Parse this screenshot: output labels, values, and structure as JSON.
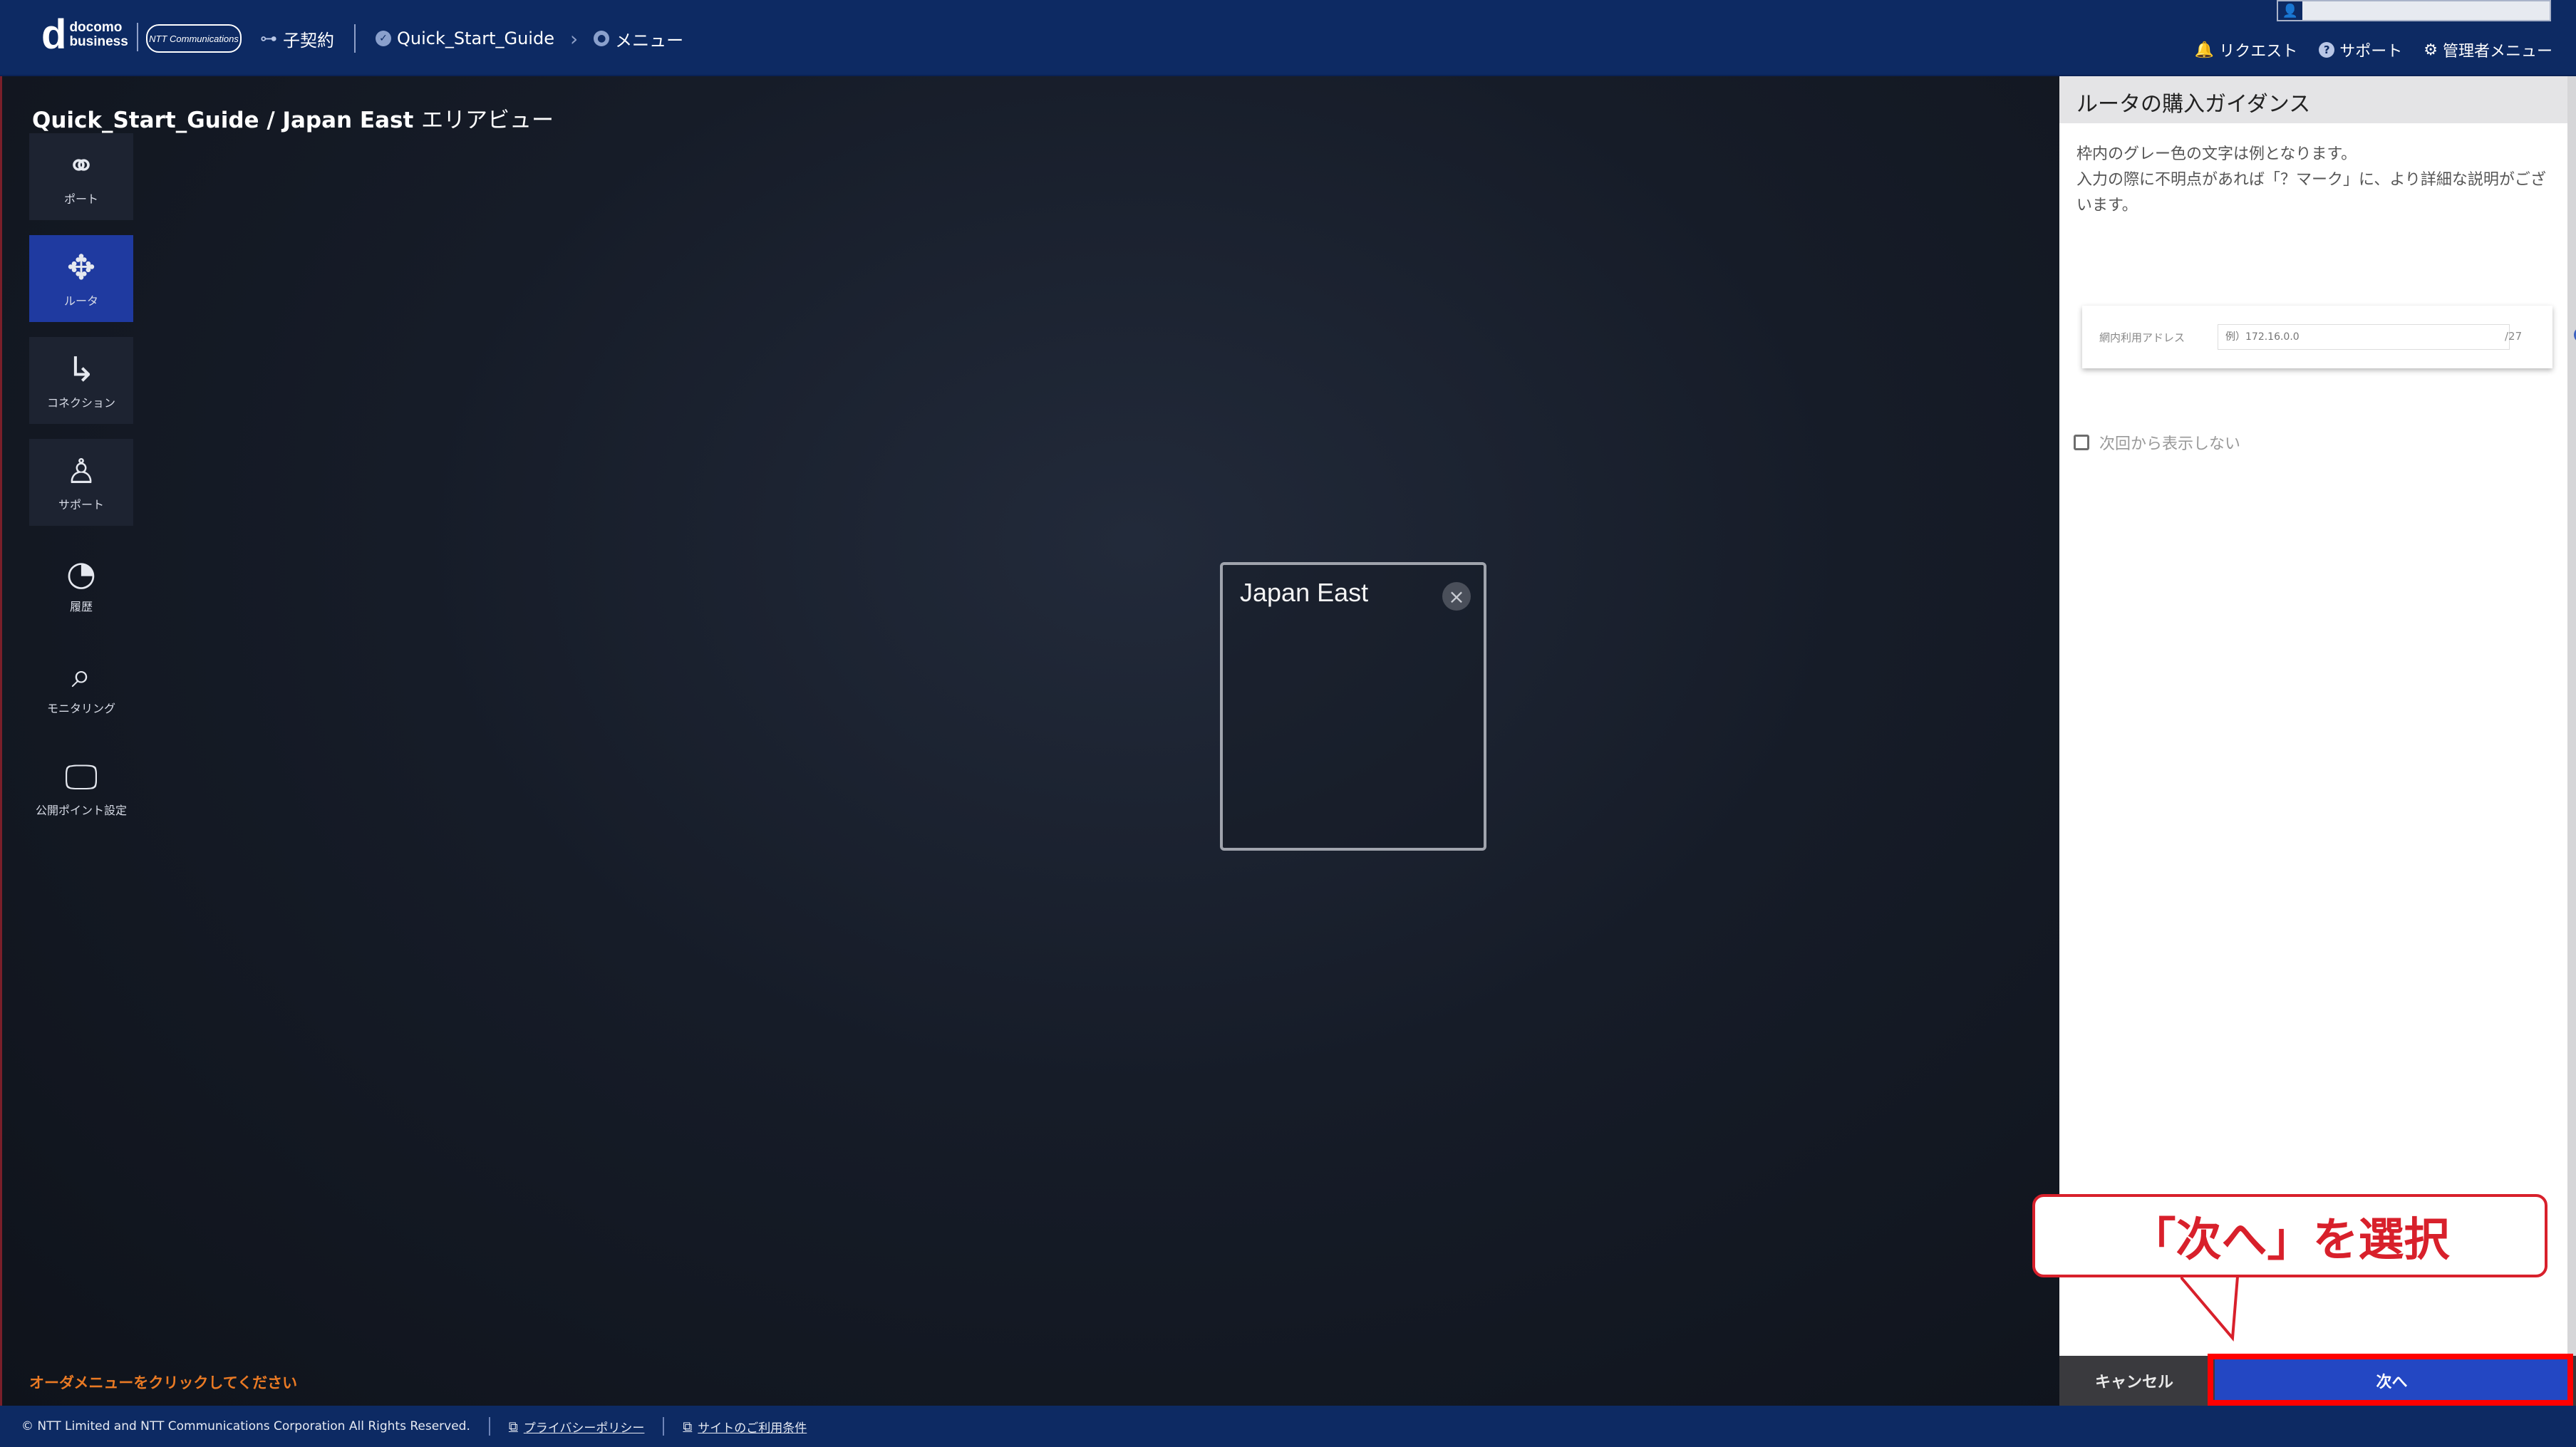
{
  "header": {
    "logo_d": "d",
    "logo_line1": "docomo",
    "logo_line2": "business",
    "ntt_logo": "NTT Communications",
    "contract_label": "子契約",
    "breadcrumb": [
      "Quick_Start_Guide",
      "メニュー"
    ],
    "user_name": "",
    "links": [
      {
        "label": "リクエスト",
        "icon": "bell-icon"
      },
      {
        "label": "サポート",
        "icon": "question-icon"
      },
      {
        "label": "管理者メニュー",
        "icon": "gear-icon"
      }
    ]
  },
  "main": {
    "title": "Quick_Start_Guide / Japan East",
    "title_suffix": "エリアビュー",
    "nav": [
      {
        "label": "ポート",
        "icon": "port-icon"
      },
      {
        "label": "ルータ",
        "icon": "router-icon",
        "active": true
      },
      {
        "label": "コネクション",
        "icon": "connection-icon"
      },
      {
        "label": "サポート",
        "icon": "support-icon"
      },
      {
        "label": "履歴",
        "icon": "history-icon"
      },
      {
        "label": "モニタリング",
        "icon": "monitoring-icon"
      },
      {
        "label": "公開ポイント設定",
        "icon": "monitor-icon"
      }
    ],
    "area_name": "Japan East",
    "order_hint": "オーダメニューをクリックしてください"
  },
  "panel": {
    "title": "ルータの購入ガイダンス",
    "guide_line1": "枠内のグレー色の文字は例となります。",
    "guide_line2": "入力の際に不明点があれば「？マーク」に、より詳細な説明がございます。",
    "field_label": "網内利用アドレス",
    "field_placeholder": "例）172.16.0.0",
    "field_suffix": "/27",
    "dont_show": "次回から表示しない",
    "cancel_label": "キャンセル",
    "next_label": "次へ"
  },
  "callout": {
    "text": "「次へ」を選択"
  },
  "footer": {
    "copyright": "© NTT Limited and NTT Communications Corporation All Rights Reserved.",
    "privacy": "プライバシーポリシー",
    "terms": "サイトのご利用条件"
  },
  "colors": {
    "header": "#0d2a63",
    "active_nav": "#1f3aa0",
    "next_button": "#2347c3",
    "highlight": "#ff0000",
    "hint": "#ea7a24"
  }
}
